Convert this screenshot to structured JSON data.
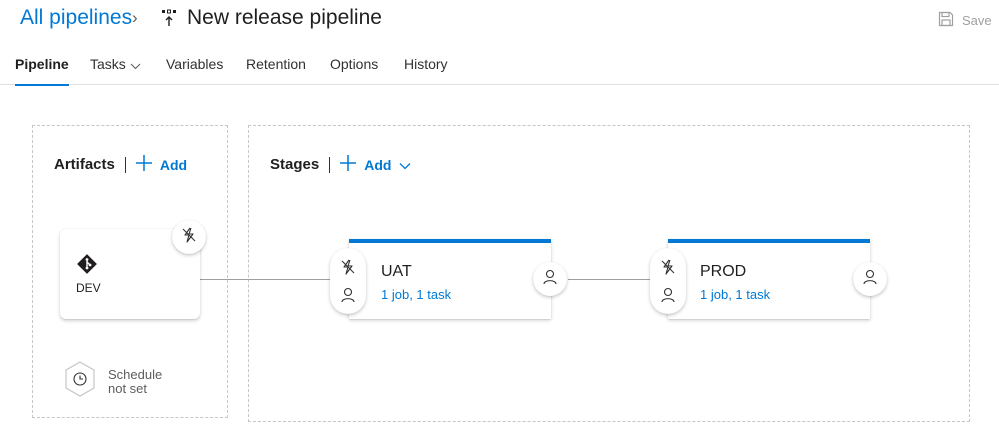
{
  "header": {
    "breadcrumb": "All pipelines",
    "breadcrumb_separator": "›",
    "title": "New release pipeline",
    "pipeline_icon": "release-pipeline-icon",
    "save_label": "Save"
  },
  "tabs": [
    {
      "label": "Pipeline",
      "active": true
    },
    {
      "label": "Tasks",
      "has_dropdown": true
    },
    {
      "label": "Variables"
    },
    {
      "label": "Retention"
    },
    {
      "label": "Options"
    },
    {
      "label": "History"
    }
  ],
  "artifacts": {
    "title": "Artifacts",
    "add_label": "Add",
    "items": [
      {
        "name": "DEV",
        "icon": "git-icon",
        "trigger_icon": "continuous-deployment-trigger-icon"
      }
    ],
    "schedule": {
      "line1": "Schedule",
      "line2": "not set",
      "icon": "clock-icon"
    }
  },
  "stages": {
    "title": "Stages",
    "add_label": "Add",
    "items": [
      {
        "name": "UAT",
        "summary": "1 job, 1 task"
      },
      {
        "name": "PROD",
        "summary": "1 job, 1 task"
      }
    ]
  },
  "colors": {
    "accent": "#0078d4",
    "text": "#201f1e",
    "muted": "#605e5c",
    "disabled": "#a19f9d"
  }
}
